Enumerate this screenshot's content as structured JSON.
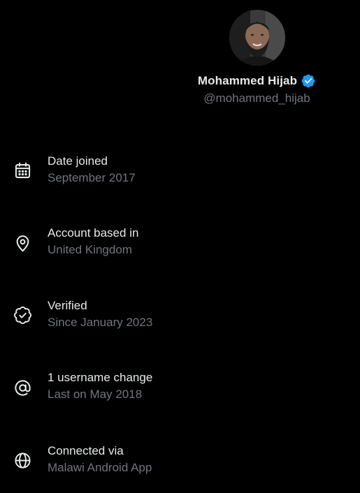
{
  "profile": {
    "name": "Mohammed Hijab",
    "handle": "@mohammed_hijab",
    "verified_color": "#1d9bf0"
  },
  "about": [
    {
      "icon": "calendar-icon",
      "title": "Date joined",
      "value": "September 2017"
    },
    {
      "icon": "location-pin-icon",
      "title": "Account based in",
      "value": "United Kingdom"
    },
    {
      "icon": "verified-badge-icon",
      "title": "Verified",
      "value": "Since January 2023"
    },
    {
      "icon": "at-sign-icon",
      "title": "1 username change",
      "value": "Last on May 2018"
    },
    {
      "icon": "globe-icon",
      "title": "Connected via",
      "value": "Malawi Android App"
    }
  ],
  "colors": {
    "background": "#000000",
    "primary_text": "#e7e9ea",
    "secondary_text": "#71767b"
  }
}
